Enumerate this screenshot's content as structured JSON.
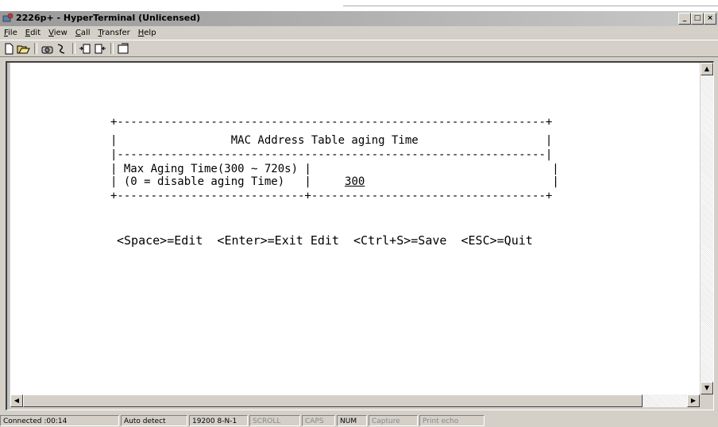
{
  "window": {
    "title": "2226p+ - HyperTerminal (Unlicensed)",
    "controls": {
      "minimize": "_",
      "maximize": "□",
      "close": "×"
    }
  },
  "menu": [
    {
      "label": "File",
      "accel": "F",
      "rest": "ile"
    },
    {
      "label": "Edit",
      "accel": "E",
      "rest": "dit"
    },
    {
      "label": "View",
      "accel": "V",
      "rest": "iew"
    },
    {
      "label": "Call",
      "accel": "C",
      "rest": "all"
    },
    {
      "label": "Transfer",
      "accel": "T",
      "rest": "ransfer"
    },
    {
      "label": "Help",
      "accel": "H",
      "rest": "elp"
    }
  ],
  "toolbar": [
    "new-icon",
    "open-icon",
    "dial-icon",
    "disconnect-icon",
    "send-icon",
    "receive-icon",
    "properties-icon"
  ],
  "terminal": {
    "border_top": "+----------------------------------------------------------------+",
    "title_line": "|                 MAC Address Table aging Time                   |",
    "separator": "|----------------------------------------------------------------|",
    "row1": "| Max Aging Time(300 ~ 720s) |                                    |",
    "row2_left": "| (0 = disable aging Time)   |     ",
    "value": "300",
    "row2_right": "                            |",
    "border_bottom": "+----------------------------+-----------------------------------+",
    "help_line": "<Space>=Edit  <Enter>=Exit Edit  <Ctrl+S>=Save  <ESC>=Quit"
  },
  "status": {
    "connected": "Connected :00:14",
    "detect": "Auto detect",
    "port": "19200 8-N-1",
    "scroll": "SCROLL",
    "caps": "CAPS",
    "num": "NUM",
    "capture": "Capture",
    "print_echo": "Print echo"
  }
}
